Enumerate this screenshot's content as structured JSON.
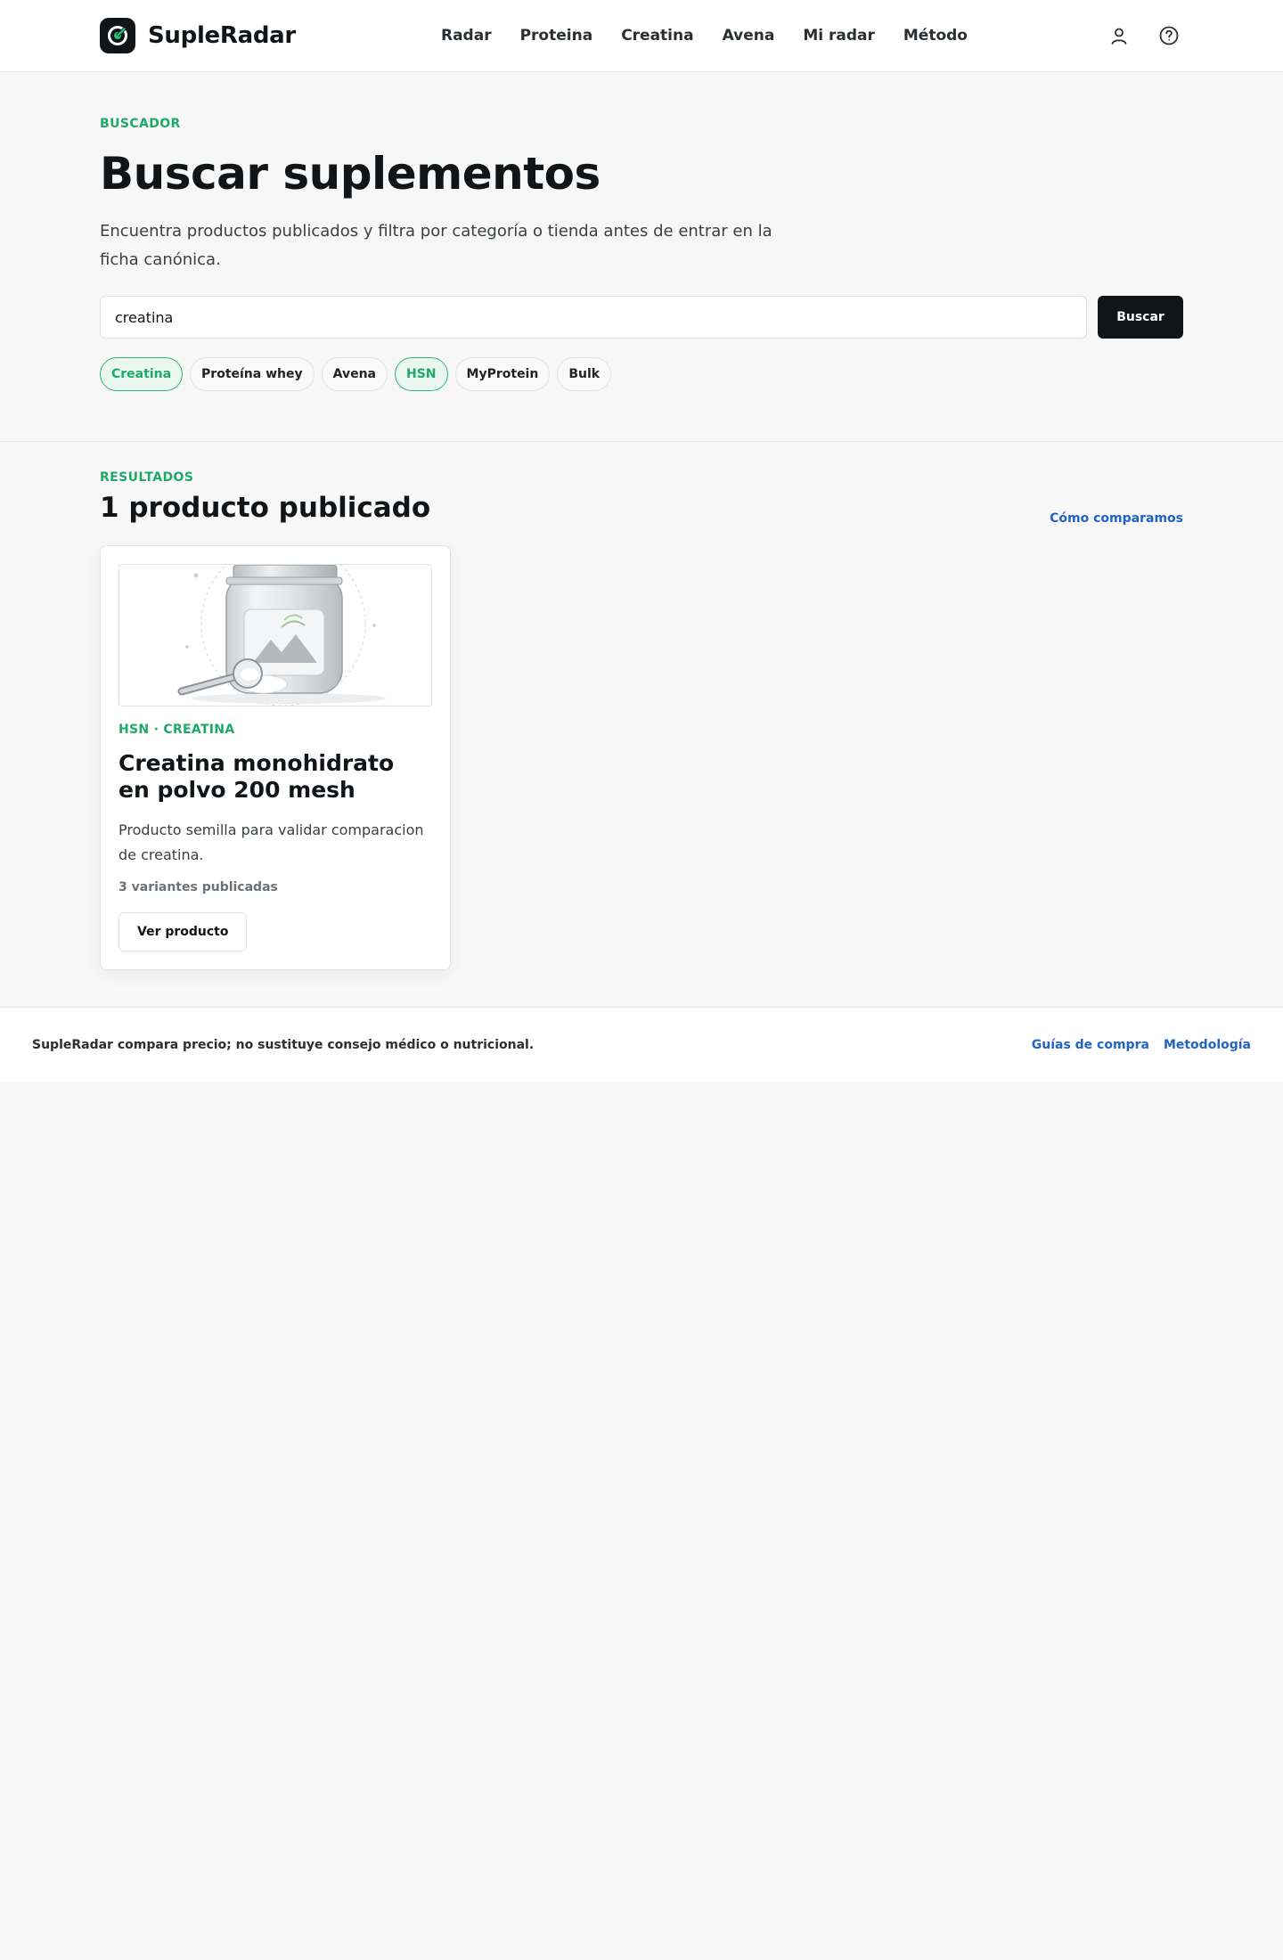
{
  "header": {
    "brand": "SupleRadar",
    "nav": [
      "Radar",
      "Proteina",
      "Creatina",
      "Avena",
      "Mi radar",
      "Método"
    ],
    "icons": [
      "user-icon",
      "help-icon"
    ]
  },
  "hero": {
    "eyebrow": "BUSCADOR",
    "title": "Buscar suplementos",
    "description": "Encuentra productos publicados y filtra por categoría o tienda antes de entrar en la ficha canónica.",
    "search_value": "creatina",
    "search_button": "Buscar",
    "chips": [
      {
        "label": "Creatina",
        "active": true
      },
      {
        "label": "Proteína whey",
        "active": false
      },
      {
        "label": "Avena",
        "active": false
      },
      {
        "label": "HSN",
        "active": true
      },
      {
        "label": "MyProtein",
        "active": false
      },
      {
        "label": "Bulk",
        "active": false
      }
    ]
  },
  "results": {
    "eyebrow": "RESULTADOS",
    "title": "1 producto publicado",
    "compare_link": "Cómo comparamos",
    "products": [
      {
        "meta": "HSN · CREATINA",
        "title": "Creatina monohidrato en polvo 200 mesh",
        "description": "Producto semilla para validar comparacion de creatina.",
        "variants": "3 variantes publicadas",
        "button": "Ver producto"
      }
    ]
  },
  "footer": {
    "note": "SupleRadar compara precio; no sustituye consejo médico o nutricional.",
    "links": [
      "Guías de compra",
      "Metodología"
    ]
  },
  "colors": {
    "accent": "#1ea96a",
    "link": "#2163c6",
    "dark": "#121517"
  }
}
